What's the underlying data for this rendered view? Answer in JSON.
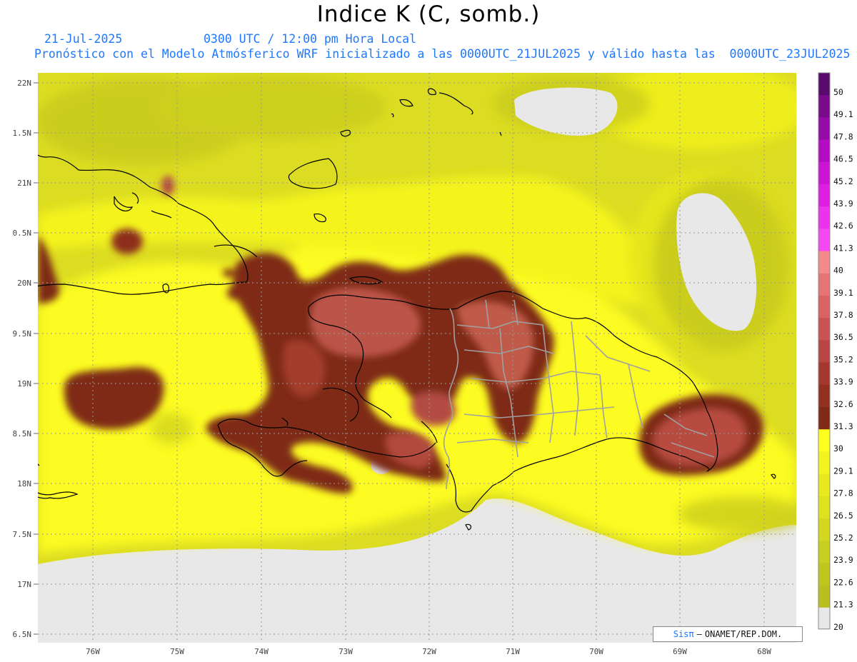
{
  "title": "Indice K (C, somb.)",
  "subtitle": {
    "date": "21-Jul-2025",
    "time": "0300 UTC / 12:00 pm Hora Local",
    "description": "Pronóstico con el Modelo Atmósferico WRF inicializado a las 0000UTC_21JUL2025 y válido hasta las  0000UTC_23JUL2025"
  },
  "map": {
    "lat_labels": [
      "22N",
      "1.5N",
      "21N",
      "0.5N",
      "20N",
      "9.5N",
      "19N",
      "8.5N",
      "18N",
      "7.5N",
      "17N",
      "6.5N"
    ],
    "lon_labels": [
      "76W",
      "75W",
      "74W",
      "73W",
      "72W",
      "71W",
      "70W",
      "69W",
      "68W"
    ]
  },
  "colorbar": {
    "labels": [
      "50",
      "49.1",
      "47.8",
      "46.5",
      "45.2",
      "43.9",
      "42.6",
      "41.3",
      "40",
      "39.1",
      "37.8",
      "36.5",
      "35.2",
      "33.9",
      "32.6",
      "31.3",
      "30",
      "29.1",
      "27.8",
      "26.5",
      "25.2",
      "23.9",
      "22.6",
      "21.3",
      "20"
    ],
    "colors": [
      "#5a0a6e",
      "#7a0a8c",
      "#960aa8",
      "#b40cc3",
      "#cc14d4",
      "#de1ee0",
      "#ec32ea",
      "#f648f2",
      "#f38a8a",
      "#e77474",
      "#d96262",
      "#c95252",
      "#b84444",
      "#a5382e",
      "#93301f",
      "#7e2a16",
      "#ffff1e",
      "#f3f31e",
      "#e8ea1e",
      "#dde21e",
      "#d3d81e",
      "#c9cf1e",
      "#c0c61e",
      "#b8bf1e"
    ],
    "below_color": "#e8e8e8"
  },
  "credit": {
    "brand": "Sisπ",
    "separator": "–",
    "org": "ONAMET/REP.DOM."
  }
}
